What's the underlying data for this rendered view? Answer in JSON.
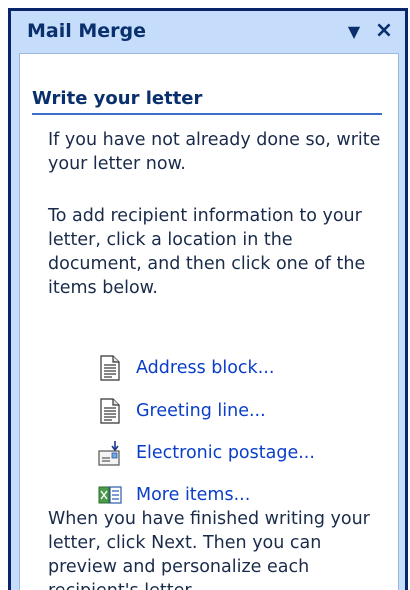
{
  "pane": {
    "title": "Mail Merge",
    "dropdown_glyph": "▼",
    "close_glyph": "×"
  },
  "section": {
    "heading": "Write your letter",
    "paragraph1": "If you have not already done so, write your letter now.",
    "paragraph2": "To add recipient information to your letter, click a location in the document, and then click one of the items below.",
    "items": [
      {
        "label": "Address block...",
        "icon": "document-icon"
      },
      {
        "label": "Greeting line...",
        "icon": "document-icon"
      },
      {
        "label": "Electronic postage...",
        "icon": "postage-icon"
      },
      {
        "label": "More items...",
        "icon": "more-items-icon"
      }
    ],
    "paragraph3": "When you have finished writing your letter, click Next. Then you can preview and personalize each recipient's letter."
  },
  "colors": {
    "pane_background": "#c5ddfb",
    "title": "#0a2f6d",
    "link": "#0a3ec9",
    "heading_rule": "#3a6ecf"
  }
}
